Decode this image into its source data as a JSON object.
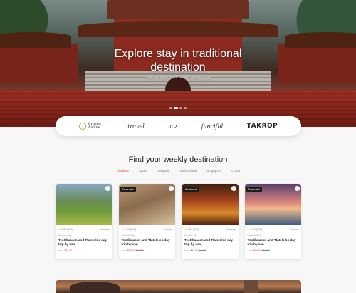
{
  "hero": {
    "title": "Explore stay in traditional destination",
    "subtitle": "A little description of what awaits to discover people"
  },
  "partners": [
    {
      "name": "Crosier Airline",
      "icon": "compass-circle-icon"
    },
    {
      "name": "travel"
    },
    {
      "name": "mo"
    },
    {
      "name": "fanciful"
    },
    {
      "name": "TAKROP"
    }
  ],
  "section": {
    "title": "Find your weekly destination"
  },
  "tabs": [
    "Thailand",
    "Spain",
    "Malaysia",
    "Switzerland",
    "Singapore",
    "China"
  ],
  "active_tab": "Thailand",
  "cards": [
    {
      "badge": "",
      "rating": "4.95 (345)",
      "duration": "8 hours",
      "location": "Mexico City",
      "title": "Teotihuacan and Tlatelolco day trip by van",
      "price_prefix": "from",
      "price": "$34.00",
      "old_price": ""
    },
    {
      "badge": "Featured",
      "rating": "4.94 (120)",
      "duration": "8 hours",
      "location": "Mexico City",
      "title": "Teotihuacan and Tlatelolco day trip by van",
      "price_prefix": "from",
      "price": "$34.00",
      "old_price": "$44.00"
    },
    {
      "badge": "Featured",
      "rating": "4.94 (120)",
      "duration": "8 hours",
      "location": "Mexico City",
      "title": "Teotihuacan and Tlatelolco day trip by van",
      "price_prefix": "from",
      "price": "$34.00",
      "old_price": "$44.00"
    },
    {
      "badge": "Featured",
      "rating": "4.94 (120)",
      "duration": "8 hours",
      "location": "Mexico City",
      "title": "Teotihuacan and Tlatelolco day trip by van",
      "price_prefix": "from",
      "price": "$34.00",
      "old_price": "$44.00"
    }
  ],
  "colors": {
    "accent": "#e2492f",
    "badge": "#1c1c1c",
    "star": "#f2b01e"
  }
}
